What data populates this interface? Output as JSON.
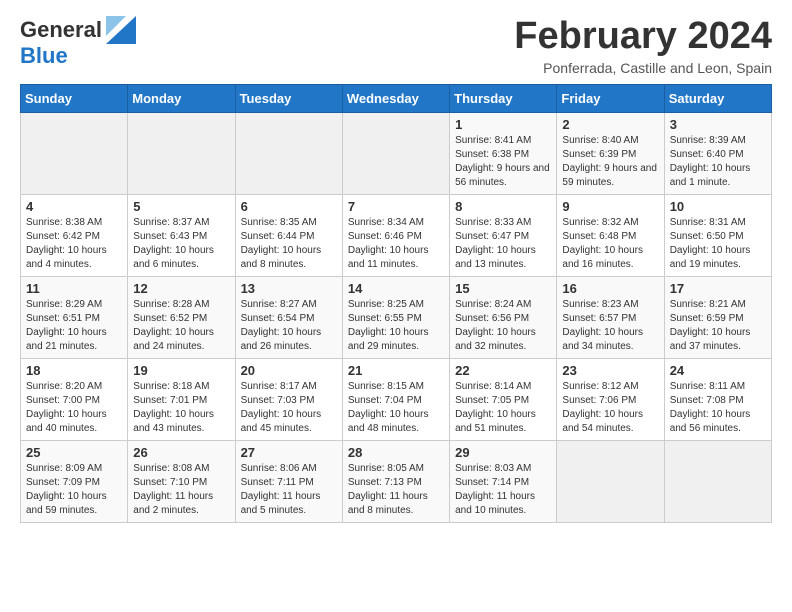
{
  "header": {
    "logo_general": "General",
    "logo_blue": "Blue",
    "title": "February 2024",
    "subtitle": "Ponferrada, Castille and Leon, Spain"
  },
  "weekdays": [
    "Sunday",
    "Monday",
    "Tuesday",
    "Wednesday",
    "Thursday",
    "Friday",
    "Saturday"
  ],
  "weeks": [
    [
      {
        "day": "",
        "info": ""
      },
      {
        "day": "",
        "info": ""
      },
      {
        "day": "",
        "info": ""
      },
      {
        "day": "",
        "info": ""
      },
      {
        "day": "1",
        "info": "Sunrise: 8:41 AM\nSunset: 6:38 PM\nDaylight: 9 hours and 56 minutes."
      },
      {
        "day": "2",
        "info": "Sunrise: 8:40 AM\nSunset: 6:39 PM\nDaylight: 9 hours and 59 minutes."
      },
      {
        "day": "3",
        "info": "Sunrise: 8:39 AM\nSunset: 6:40 PM\nDaylight: 10 hours and 1 minute."
      }
    ],
    [
      {
        "day": "4",
        "info": "Sunrise: 8:38 AM\nSunset: 6:42 PM\nDaylight: 10 hours and 4 minutes."
      },
      {
        "day": "5",
        "info": "Sunrise: 8:37 AM\nSunset: 6:43 PM\nDaylight: 10 hours and 6 minutes."
      },
      {
        "day": "6",
        "info": "Sunrise: 8:35 AM\nSunset: 6:44 PM\nDaylight: 10 hours and 8 minutes."
      },
      {
        "day": "7",
        "info": "Sunrise: 8:34 AM\nSunset: 6:46 PM\nDaylight: 10 hours and 11 minutes."
      },
      {
        "day": "8",
        "info": "Sunrise: 8:33 AM\nSunset: 6:47 PM\nDaylight: 10 hours and 13 minutes."
      },
      {
        "day": "9",
        "info": "Sunrise: 8:32 AM\nSunset: 6:48 PM\nDaylight: 10 hours and 16 minutes."
      },
      {
        "day": "10",
        "info": "Sunrise: 8:31 AM\nSunset: 6:50 PM\nDaylight: 10 hours and 19 minutes."
      }
    ],
    [
      {
        "day": "11",
        "info": "Sunrise: 8:29 AM\nSunset: 6:51 PM\nDaylight: 10 hours and 21 minutes."
      },
      {
        "day": "12",
        "info": "Sunrise: 8:28 AM\nSunset: 6:52 PM\nDaylight: 10 hours and 24 minutes."
      },
      {
        "day": "13",
        "info": "Sunrise: 8:27 AM\nSunset: 6:54 PM\nDaylight: 10 hours and 26 minutes."
      },
      {
        "day": "14",
        "info": "Sunrise: 8:25 AM\nSunset: 6:55 PM\nDaylight: 10 hours and 29 minutes."
      },
      {
        "day": "15",
        "info": "Sunrise: 8:24 AM\nSunset: 6:56 PM\nDaylight: 10 hours and 32 minutes."
      },
      {
        "day": "16",
        "info": "Sunrise: 8:23 AM\nSunset: 6:57 PM\nDaylight: 10 hours and 34 minutes."
      },
      {
        "day": "17",
        "info": "Sunrise: 8:21 AM\nSunset: 6:59 PM\nDaylight: 10 hours and 37 minutes."
      }
    ],
    [
      {
        "day": "18",
        "info": "Sunrise: 8:20 AM\nSunset: 7:00 PM\nDaylight: 10 hours and 40 minutes."
      },
      {
        "day": "19",
        "info": "Sunrise: 8:18 AM\nSunset: 7:01 PM\nDaylight: 10 hours and 43 minutes."
      },
      {
        "day": "20",
        "info": "Sunrise: 8:17 AM\nSunset: 7:03 PM\nDaylight: 10 hours and 45 minutes."
      },
      {
        "day": "21",
        "info": "Sunrise: 8:15 AM\nSunset: 7:04 PM\nDaylight: 10 hours and 48 minutes."
      },
      {
        "day": "22",
        "info": "Sunrise: 8:14 AM\nSunset: 7:05 PM\nDaylight: 10 hours and 51 minutes."
      },
      {
        "day": "23",
        "info": "Sunrise: 8:12 AM\nSunset: 7:06 PM\nDaylight: 10 hours and 54 minutes."
      },
      {
        "day": "24",
        "info": "Sunrise: 8:11 AM\nSunset: 7:08 PM\nDaylight: 10 hours and 56 minutes."
      }
    ],
    [
      {
        "day": "25",
        "info": "Sunrise: 8:09 AM\nSunset: 7:09 PM\nDaylight: 10 hours and 59 minutes."
      },
      {
        "day": "26",
        "info": "Sunrise: 8:08 AM\nSunset: 7:10 PM\nDaylight: 11 hours and 2 minutes."
      },
      {
        "day": "27",
        "info": "Sunrise: 8:06 AM\nSunset: 7:11 PM\nDaylight: 11 hours and 5 minutes."
      },
      {
        "day": "28",
        "info": "Sunrise: 8:05 AM\nSunset: 7:13 PM\nDaylight: 11 hours and 8 minutes."
      },
      {
        "day": "29",
        "info": "Sunrise: 8:03 AM\nSunset: 7:14 PM\nDaylight: 11 hours and 10 minutes."
      },
      {
        "day": "",
        "info": ""
      },
      {
        "day": "",
        "info": ""
      }
    ]
  ]
}
